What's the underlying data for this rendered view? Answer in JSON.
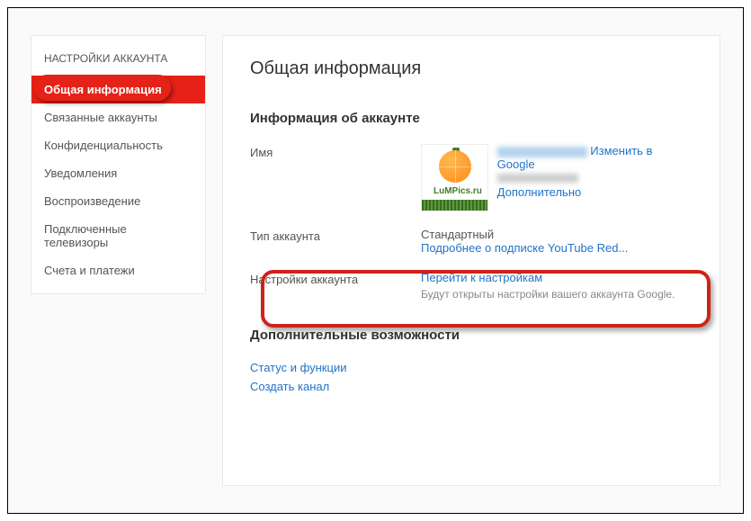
{
  "sidebar": {
    "title": "НАСТРОЙКИ АККАУНТА",
    "items": [
      {
        "label": "Общая информация",
        "active": true
      },
      {
        "label": "Связанные аккаунты",
        "active": false
      },
      {
        "label": "Конфиденциальность",
        "active": false
      },
      {
        "label": "Уведомления",
        "active": false
      },
      {
        "label": "Воспроизведение",
        "active": false
      },
      {
        "label": "Подключенные телевизоры",
        "active": false
      },
      {
        "label": "Счета и платежи",
        "active": false
      }
    ]
  },
  "main": {
    "title": "Общая информация",
    "account_info": {
      "heading": "Информация об аккаунте",
      "name_label": "Имя",
      "avatar_text": "LuMPics.ru",
      "edit_link": "Изменить в Google",
      "more_link": "Дополнительно",
      "type_label": "Тип аккаунта",
      "type_value": "Стандартный",
      "type_link": "Подробнее о подписке YouTube Red...",
      "settings_label": "Настройки аккаунта",
      "settings_link": "Перейти к настройкам",
      "settings_helper": "Будут открыты настройки вашего аккаунта Google."
    },
    "features": {
      "heading": "Дополнительные возможности",
      "status_link": "Статус и функции",
      "create_link": "Создать канал"
    }
  }
}
